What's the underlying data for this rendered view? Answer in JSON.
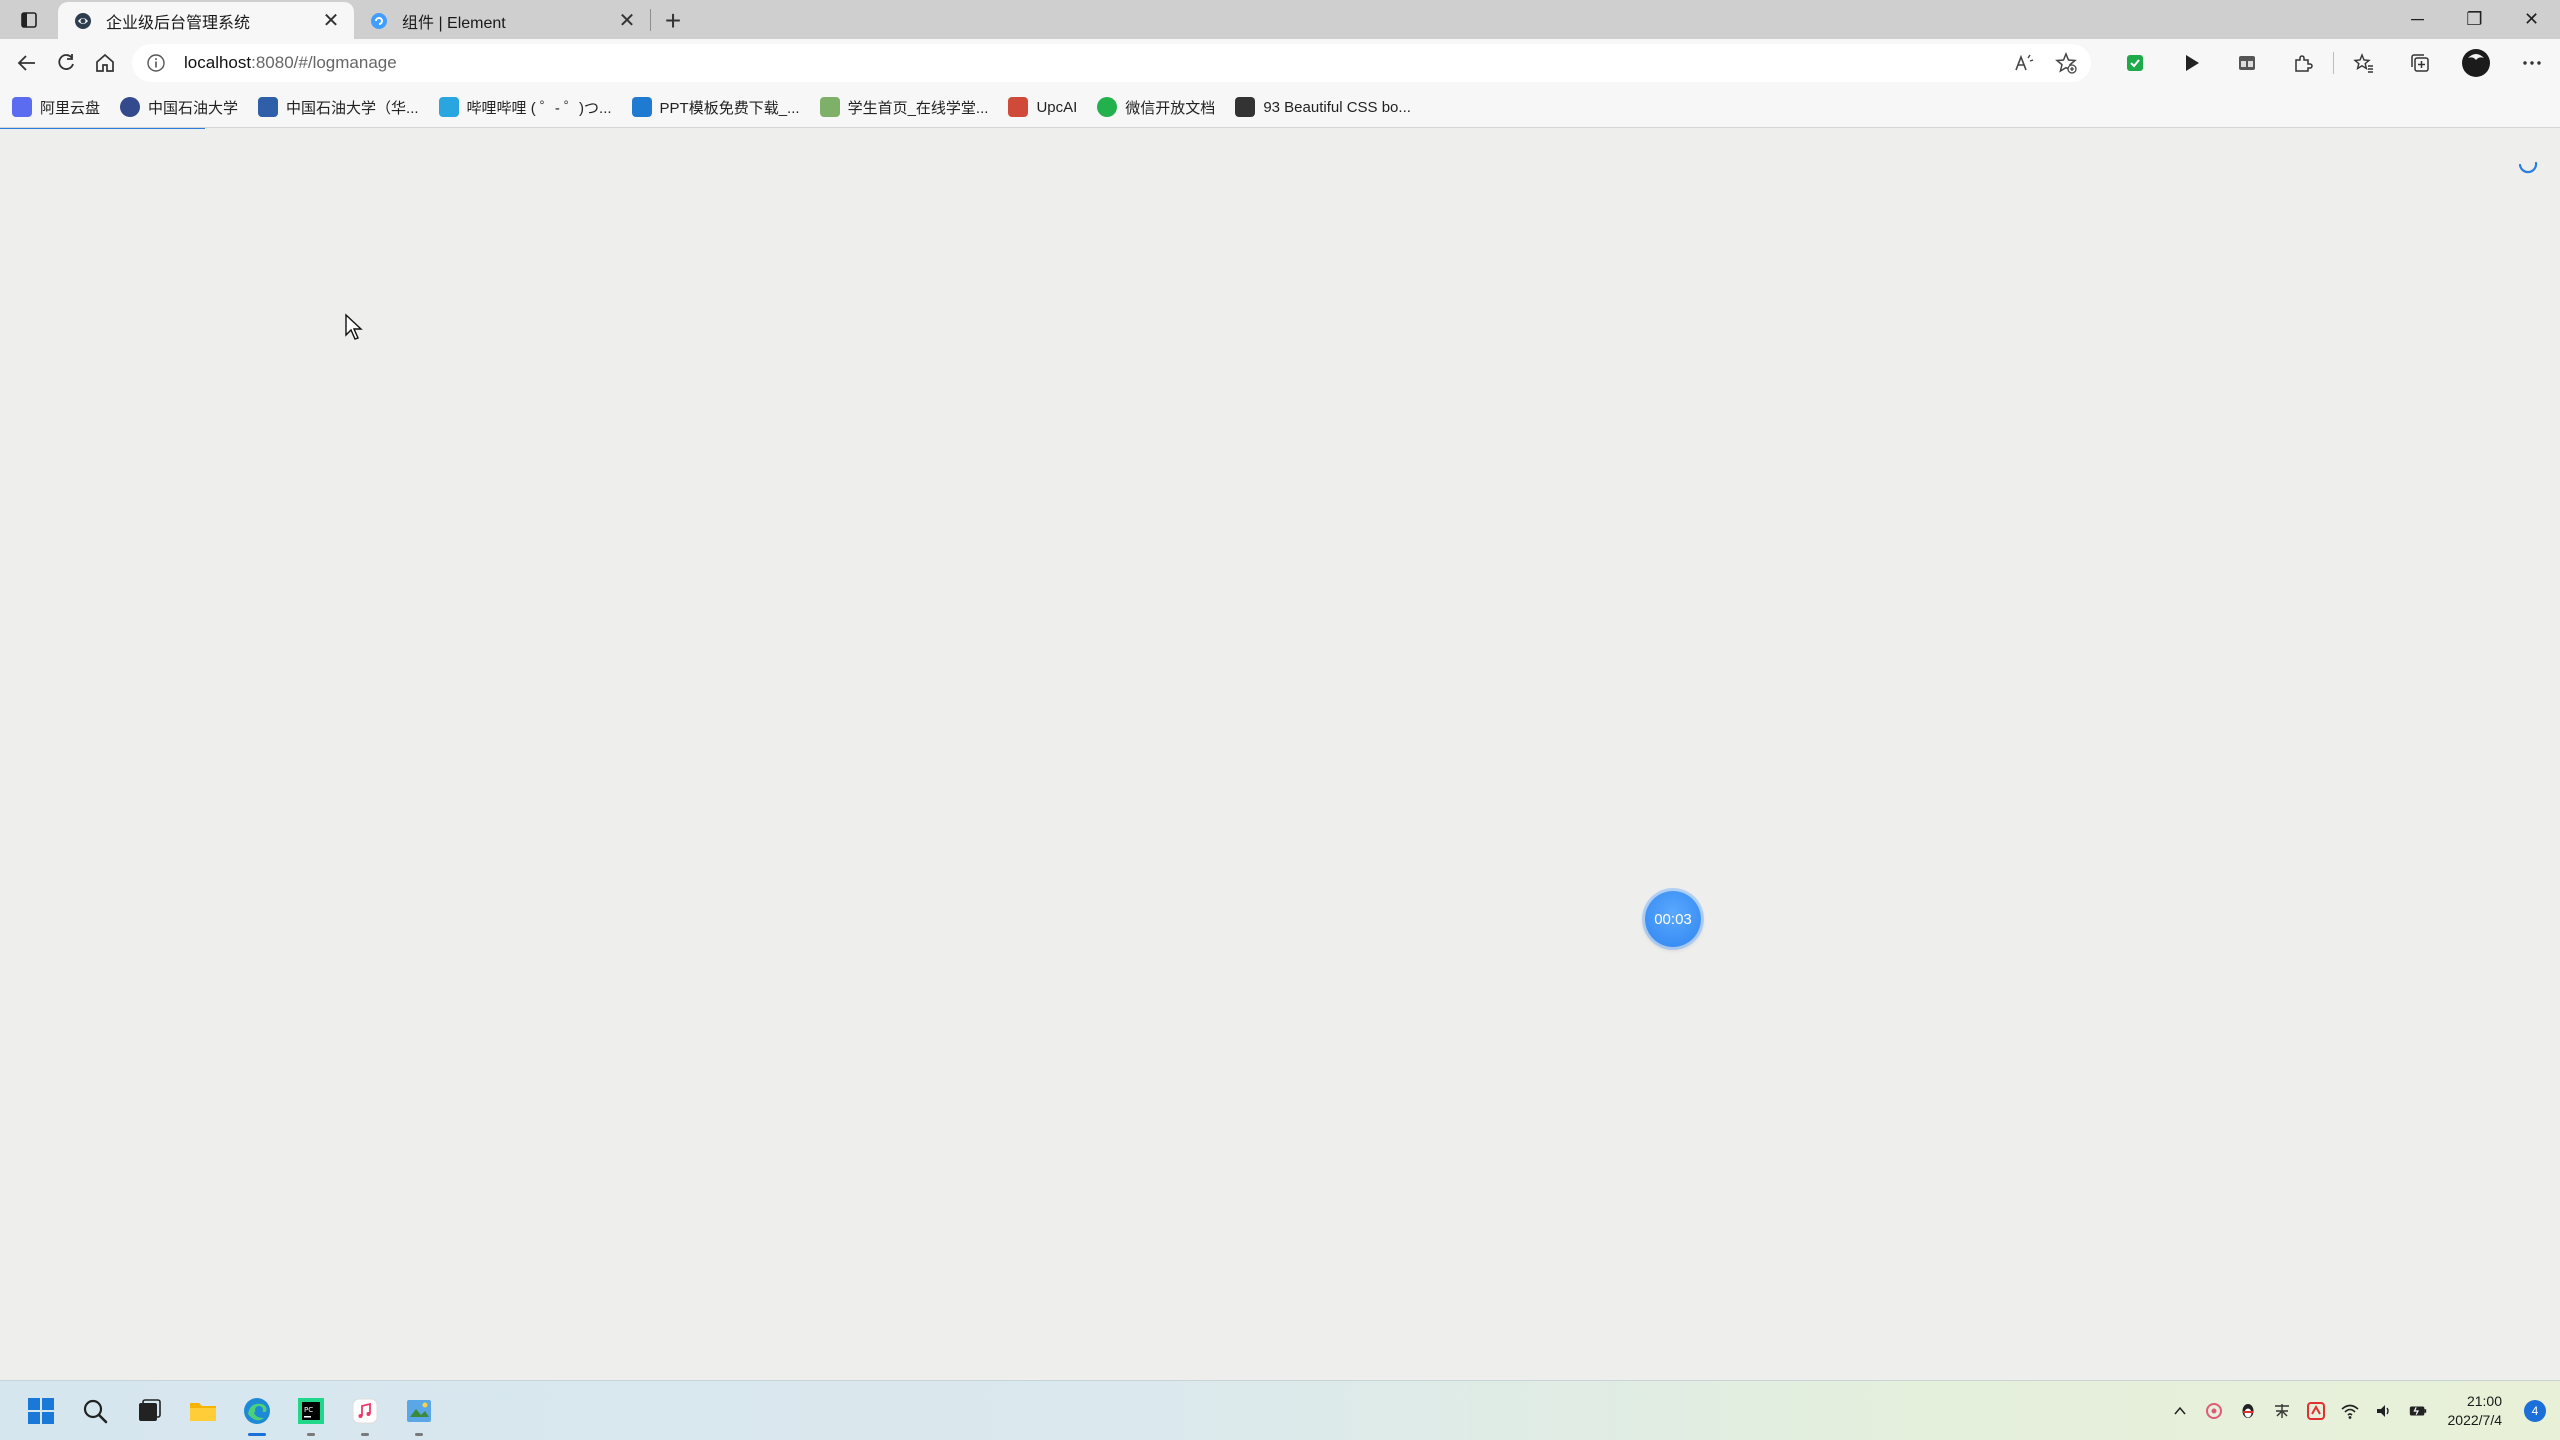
{
  "browser": {
    "tabs": [
      {
        "title": "企业级后台管理系统",
        "close": "✕"
      },
      {
        "title": "组件 | Element",
        "close": "✕"
      }
    ],
    "new_tab": "+",
    "window_controls": {
      "minimize": "─",
      "restore": "❐",
      "close": "✕"
    },
    "address": {
      "host": "localhost",
      "rest": ":8080/#/logmanage"
    },
    "bookmarks": [
      {
        "label": "阿里云盘",
        "color": "#5b6cf0"
      },
      {
        "label": "中国石油大学",
        "color": "#334a8c"
      },
      {
        "label": "中国石油大学（华...",
        "color": "#2e5fa8"
      },
      {
        "label": "哔哩哔哩 ( ゜- ゜)つ...",
        "color": "#29a6e0"
      },
      {
        "label": "PPT模板免费下载_...",
        "color": "#1f7bd1"
      },
      {
        "label": "学生首页_在线学堂...",
        "color": "#7fb06a"
      },
      {
        "label": "UpcAI",
        "color": "#d04a3a"
      },
      {
        "label": "微信开放文档",
        "color": "#22b14c"
      },
      {
        "label": "93 Beautiful CSS bo...",
        "color": "#333333"
      }
    ]
  },
  "page": {
    "recording_timer": "00:03"
  },
  "taskbar": {
    "clock_time": "21:00",
    "clock_date": "2022/7/4",
    "notification_count": "4",
    "apps": [
      {
        "name": "start",
        "running": false
      },
      {
        "name": "search",
        "running": false
      },
      {
        "name": "task-view",
        "running": false
      },
      {
        "name": "file-explorer",
        "running": false
      },
      {
        "name": "edge",
        "running": true,
        "active": true
      },
      {
        "name": "pycharm",
        "running": true
      },
      {
        "name": "music",
        "running": true
      },
      {
        "name": "screenshot-tool",
        "running": true
      }
    ]
  }
}
